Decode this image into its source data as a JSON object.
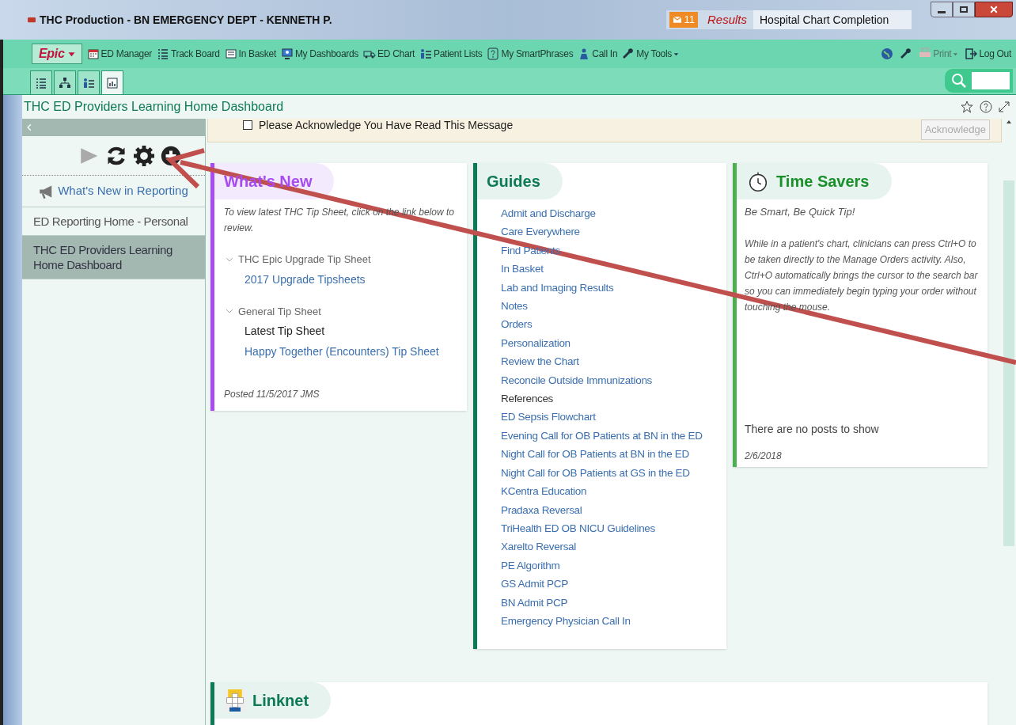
{
  "window": {
    "title": "THC Production - BN EMERGENCY DEPT - KENNETH P.",
    "notification_count": "11",
    "results_label": "Results",
    "inbox_label": "Hospital Chart Completion"
  },
  "toolbar": {
    "epic_label": "Epic",
    "items": [
      {
        "label": "ED Manager",
        "dropdown": false
      },
      {
        "label": "Track Board",
        "dropdown": false
      },
      {
        "label": "In Basket",
        "dropdown": false
      },
      {
        "label": "My Dashboards",
        "dropdown": false
      },
      {
        "label": "ED Chart",
        "dropdown": false
      },
      {
        "label": "Patient Lists",
        "dropdown": false
      },
      {
        "label": "My SmartPhrases",
        "dropdown": false
      },
      {
        "label": "Call In",
        "dropdown": false
      },
      {
        "label": "My Tools",
        "dropdown": true
      }
    ],
    "right_items": [
      {
        "label": "Print",
        "disabled": true,
        "dropdown": true
      },
      {
        "label": "Log Out",
        "disabled": false,
        "dropdown": false
      }
    ]
  },
  "view_tabs": [
    {
      "selected": false
    },
    {
      "selected": false
    },
    {
      "selected": false
    },
    {
      "selected": true
    }
  ],
  "page_title": "THC ED Providers Learning Home Dashboard",
  "sidebar": {
    "whats_new": "What's New in Reporting",
    "items": [
      {
        "label": "ED Reporting Home - Personal",
        "selected": false
      },
      {
        "label": "THC ED Providers Learning Home Dashboard",
        "selected": true
      }
    ]
  },
  "notice": {
    "checkbox_label": "Please Acknowledge You Have Read This Message",
    "checked": false,
    "button": "Acknowledge"
  },
  "cards": [
    {
      "kind": "whats_new",
      "title": "What's New",
      "color": "#a64cf0",
      "intro": "To view latest THC Tip Sheet, click on the link below to review.",
      "sections": [
        {
          "title": "THC Epic Upgrade Tip Sheet",
          "expanded": true,
          "links": [
            {
              "label": "2017 Upgrade Tipsheets",
              "kind": "link"
            }
          ]
        },
        {
          "title": "General Tip Sheet",
          "expanded": true,
          "links": [
            {
              "label": "Latest Tip Sheet",
              "kind": "text"
            },
            {
              "label": "Happy Together (Encounters) Tip Sheet",
              "kind": "link"
            }
          ]
        }
      ],
      "footer": "Posted 11/5/2017 JMS"
    },
    {
      "kind": "guides",
      "title": "Guides",
      "color": "#0e7a55",
      "links": [
        {
          "label": "Admit and Discharge",
          "kind": "link"
        },
        {
          "label": "Care Everywhere",
          "kind": "link"
        },
        {
          "label": "Find Patients",
          "kind": "link"
        },
        {
          "label": "In Basket",
          "kind": "link"
        },
        {
          "label": "Lab and Imaging Results",
          "kind": "link"
        },
        {
          "label": "Notes",
          "kind": "link"
        },
        {
          "label": "Orders",
          "kind": "link"
        },
        {
          "label": "Personalization",
          "kind": "link"
        },
        {
          "label": "Review the Chart",
          "kind": "link"
        },
        {
          "label": "Reconcile Outside Immunizations",
          "kind": "link"
        },
        {
          "label": "References",
          "kind": "text"
        },
        {
          "label": "ED Sepsis Flowchart",
          "kind": "link"
        },
        {
          "label": "Evening Call for OB Patients at BN in the ED",
          "kind": "link"
        },
        {
          "label": "Night Call for OB Patients at BN in the ED",
          "kind": "link"
        },
        {
          "label": "Night Call for OB Patients at GS in the ED",
          "kind": "link"
        },
        {
          "label": "KCentra Education",
          "kind": "link"
        },
        {
          "label": "Pradaxa Reversal",
          "kind": "link"
        },
        {
          "label": "TriHealth ED OB NICU Guidelines",
          "kind": "link"
        },
        {
          "label": "Xarelto Reversal",
          "kind": "link"
        },
        {
          "label": "PE Algorithm",
          "kind": "link"
        },
        {
          "label": "GS Admit PCP",
          "kind": "link"
        },
        {
          "label": "BN Admit PCP",
          "kind": "link"
        },
        {
          "label": "Emergency Physician Call In",
          "kind": "link"
        }
      ]
    },
    {
      "kind": "time_savers",
      "title": "Time Savers",
      "color": "#4caf50",
      "tip_title": "Be Smart, Be Quick Tip!",
      "tip": "While in a patient's chart, clinicians can press Ctrl+O to be taken directly to the Manage Orders activity. Also, Ctrl+O automatically brings the cursor to the search bar so you can immediately begin typing your order without touching the mouse.",
      "empty": "There are no posts to show",
      "footer": "2/6/2018"
    },
    {
      "kind": "linknet",
      "title": "Linknet",
      "color": "#0e7a55"
    }
  ]
}
